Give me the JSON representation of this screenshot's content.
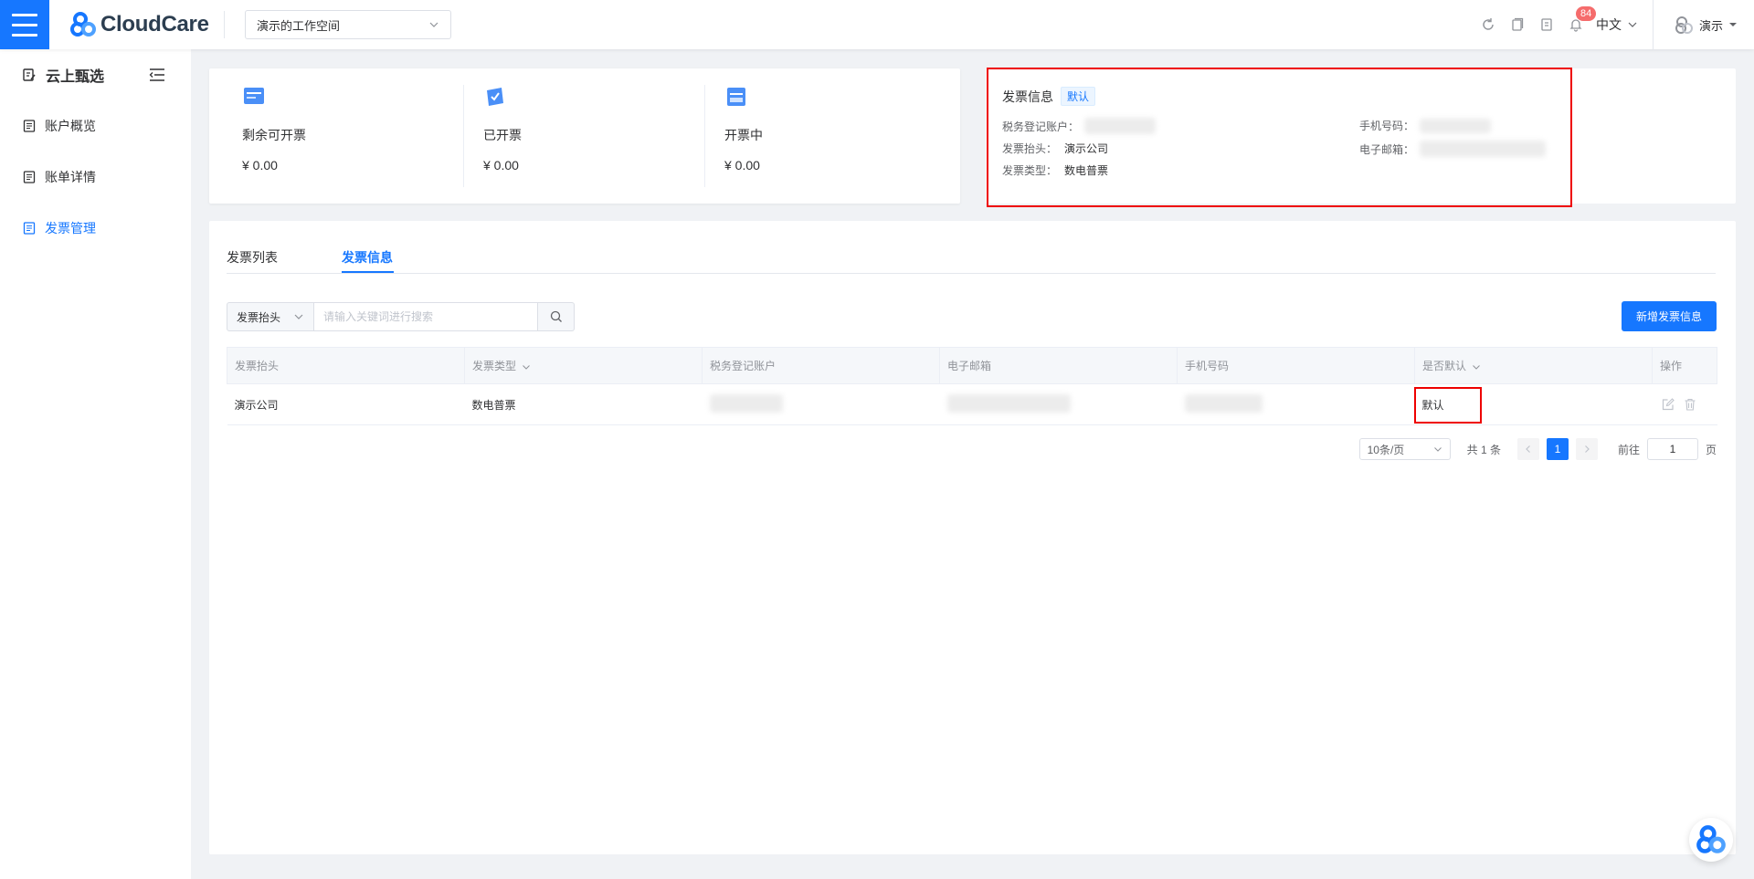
{
  "header": {
    "logo_text": "CloudCare",
    "workspace": "演示的工作空间",
    "notification_count": "84",
    "language": "中文",
    "user": "演示"
  },
  "sidebar": {
    "title": "云上甄选",
    "items": [
      {
        "label": "账户概览",
        "active": false
      },
      {
        "label": "账单详情",
        "active": false
      },
      {
        "label": "发票管理",
        "active": true
      }
    ]
  },
  "stats": [
    {
      "label": "剩余可开票",
      "value": "¥ 0.00"
    },
    {
      "label": "已开票",
      "value": "¥ 0.00"
    },
    {
      "label": "开票中",
      "value": "¥ 0.00"
    }
  ],
  "invoice_info": {
    "title": "发票信息",
    "tag": "默认",
    "tax_account_label": "税务登记账户：",
    "header_label": "发票抬头：",
    "header_value": "演示公司",
    "type_label": "发票类型：",
    "type_value": "数电普票",
    "phone_label": "手机号码：",
    "email_label": "电子邮箱："
  },
  "tabs": [
    {
      "label": "发票列表",
      "active": false
    },
    {
      "label": "发票信息",
      "active": true
    }
  ],
  "search": {
    "select_value": "发票抬头",
    "placeholder": "请输入关键词进行搜索"
  },
  "add_button": "新增发票信息",
  "table": {
    "columns": [
      "发票抬头",
      "发票类型",
      "税务登记账户",
      "电子邮箱",
      "手机号码",
      "是否默认",
      "操作"
    ],
    "rows": [
      {
        "header": "演示公司",
        "type": "数电普票",
        "is_default": "默认"
      }
    ]
  },
  "pagination": {
    "page_size": "10条/页",
    "total": "共 1 条",
    "current_page": "1",
    "goto_label": "前往",
    "goto_value": "1",
    "page_suffix": "页"
  },
  "colors": {
    "primary": "#1677ff",
    "highlight": "#ee0000"
  }
}
